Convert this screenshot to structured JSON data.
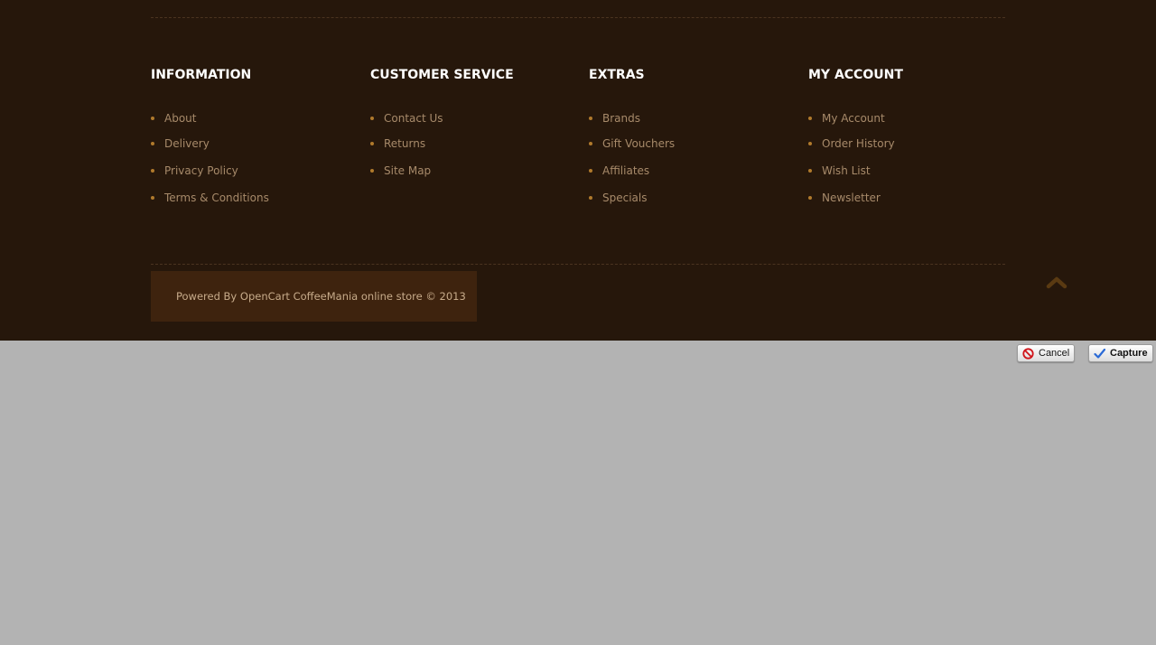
{
  "footer": {
    "columns": [
      {
        "title": "INFORMATION",
        "links": [
          "About",
          "Delivery",
          "Privacy Policy",
          "Terms & Conditions"
        ]
      },
      {
        "title": "CUSTOMER SERVICE",
        "links": [
          "Contact Us",
          "Returns",
          "Site Map"
        ]
      },
      {
        "title": "EXTRAS",
        "links": [
          "Brands",
          "Gift Vouchers",
          "Affiliates",
          "Specials"
        ]
      },
      {
        "title": "MY ACCOUNT",
        "links": [
          "My Account",
          "Order History",
          "Wish List",
          "Newsletter"
        ]
      }
    ],
    "powered_by": "Powered By OpenCart CoffeeMania online store © 2013",
    "back_to_top_icon": "chevron-up-icon"
  },
  "capture_toolbar": {
    "cancel_label": "Cancel",
    "capture_label": "Capture",
    "cancel_icon": "no-entry-icon",
    "capture_icon": "checkmark-icon"
  },
  "colors": {
    "footer_bg": "#26170b",
    "powered_bg": "#3e230e",
    "link": "#a78a6a",
    "bullet": "#b07a2c",
    "page_bg": "#b3b3b3"
  }
}
